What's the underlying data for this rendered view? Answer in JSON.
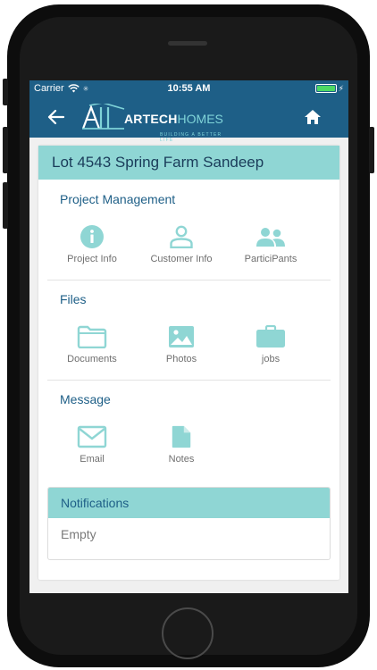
{
  "status_bar": {
    "carrier": "Carrier",
    "time": "10:55 AM"
  },
  "nav": {
    "brand_bold": "ARTECH",
    "brand_light": "HOMES",
    "tagline": "BUILDING A BETTER LIFE"
  },
  "project": {
    "title": "Lot 4543 Spring Farm Sandeep",
    "sections": {
      "management": {
        "title": "Project Management",
        "items": [
          {
            "label": "Project Info",
            "icon": "info-icon"
          },
          {
            "label": "Customer Info",
            "icon": "person-icon"
          },
          {
            "label": "ParticiPants",
            "icon": "people-icon"
          }
        ]
      },
      "files": {
        "title": "Files",
        "items": [
          {
            "label": "Documents",
            "icon": "folder-icon"
          },
          {
            "label": "Photos",
            "icon": "image-icon"
          },
          {
            "label": "jobs",
            "icon": "briefcase-icon"
          }
        ]
      },
      "message": {
        "title": "Message",
        "items": [
          {
            "label": "Email",
            "icon": "envelope-icon"
          },
          {
            "label": "Notes",
            "icon": "document-icon"
          }
        ]
      }
    },
    "notifications": {
      "title": "Notifications",
      "body": "Empty"
    }
  },
  "colors": {
    "primary": "#1e5f87",
    "accent": "#8fd6d4",
    "icon": "#8fd6d4",
    "battery": "#4cd964"
  }
}
